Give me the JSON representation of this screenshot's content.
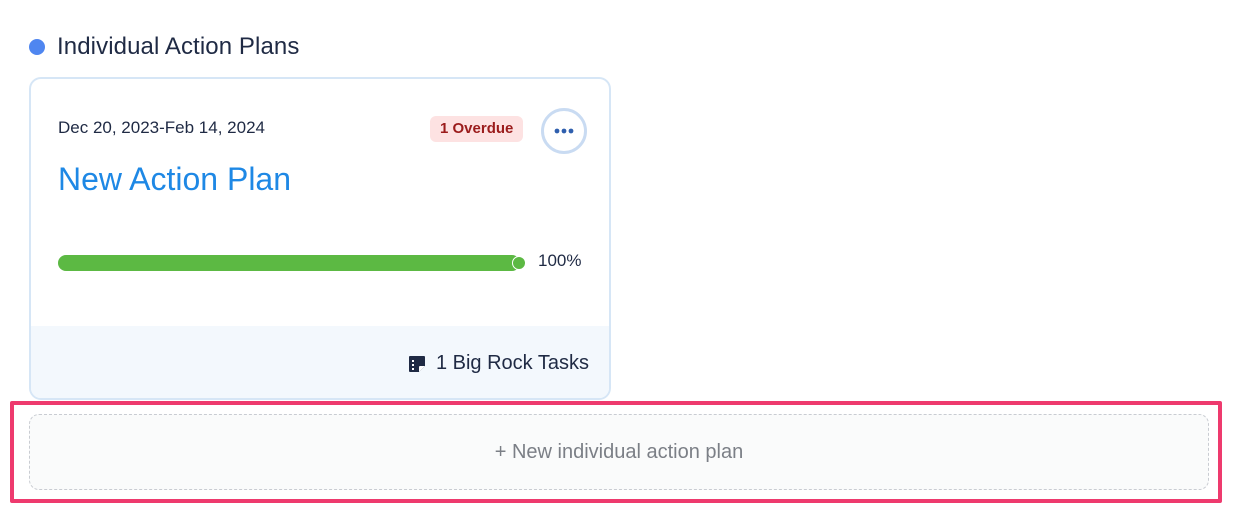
{
  "section": {
    "title": "Individual Action Plans",
    "dot_color": "#4f86f0"
  },
  "plan_card": {
    "date_range": "Dec 20, 2023-Feb 14, 2024",
    "overdue_badge": "1 Overdue",
    "title": "New Action Plan",
    "progress_percent": 100,
    "progress_label": "100%",
    "footer_icon": "sticky-note-icon",
    "tasks_label": "1 Big Rock Tasks",
    "more_icon": "ellipsis-icon"
  },
  "new_plan": {
    "label": "+ New individual action plan"
  },
  "colors": {
    "accent_blue": "#1e88e5",
    "progress_green": "#5cb943",
    "overdue_red": "#9b1c1c",
    "highlight_pink": "#ee3a6e"
  }
}
